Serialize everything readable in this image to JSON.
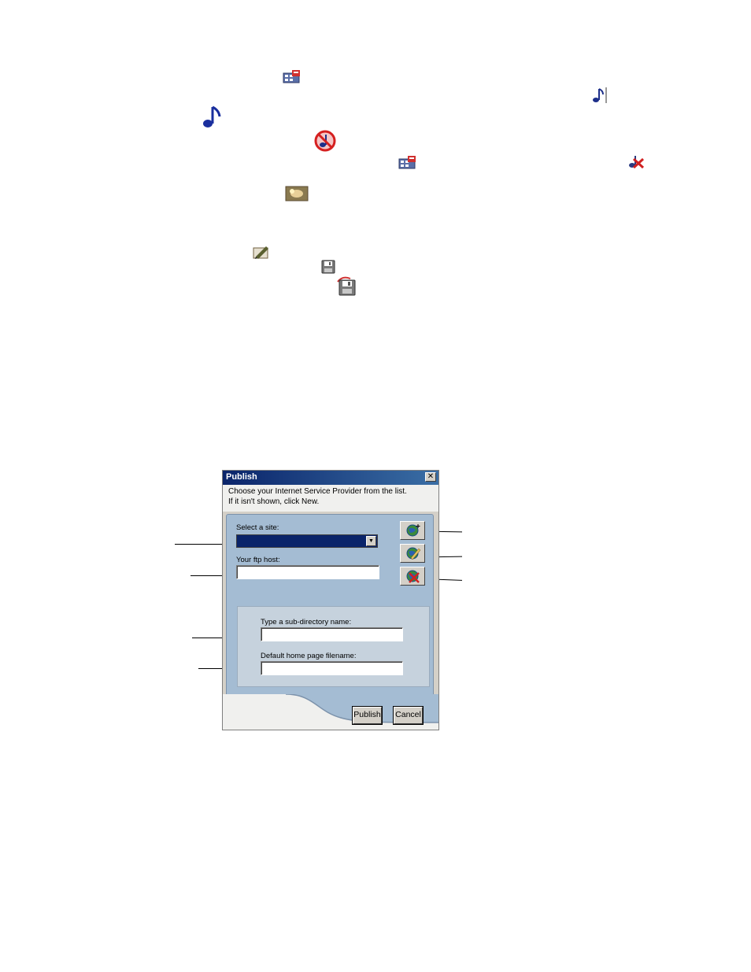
{
  "icons": [
    {
      "name": "record-icon"
    },
    {
      "name": "music-note-bar-icon"
    },
    {
      "name": "music-note-icon"
    },
    {
      "name": "no-music-icon"
    },
    {
      "name": "record-icon-2"
    },
    {
      "name": "delete-music-icon"
    },
    {
      "name": "photo-icon"
    },
    {
      "name": "edit-icon"
    },
    {
      "name": "save-icon"
    },
    {
      "name": "save-as-icon"
    }
  ],
  "dialog": {
    "title": "Publish",
    "close_label": "✕",
    "instructions_line1": "Choose your Internet Service Provider from the list.",
    "instructions_line2": "If it isn't shown, click New.",
    "select_site_label": "Select a site:",
    "select_site_value": "",
    "ftp_host_label": "Your ftp host:",
    "ftp_host_value": "",
    "subdir_label": "Type a sub-directory name:",
    "subdir_value": "",
    "homepage_label": "Default home page filename:",
    "homepage_value": "",
    "side_buttons": [
      {
        "icon": "globe-new-icon"
      },
      {
        "icon": "globe-edit-icon"
      },
      {
        "icon": "globe-delete-icon"
      }
    ],
    "publish_label": "Publish",
    "cancel_label": "Cancel"
  },
  "colors": {
    "titlebar": "#0a246a",
    "panel": "#a4bcd3",
    "selected": "#0a246a"
  }
}
